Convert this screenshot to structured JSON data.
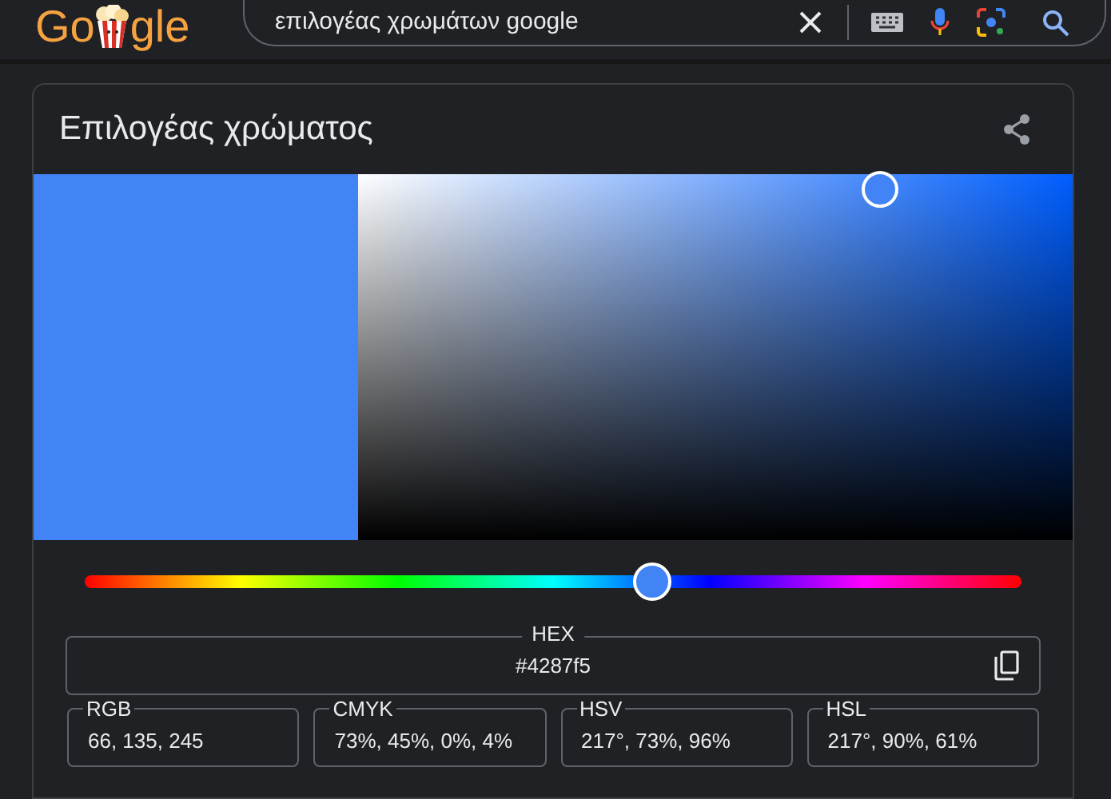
{
  "logo": {
    "before": "Go",
    "after": "gle"
  },
  "search": {
    "value": "επιλογέας χρωμάτων google"
  },
  "card": {
    "title": "Επιλογέας χρώματος",
    "hue": {
      "level": 0.605
    },
    "saturation": {
      "level": 0.73
    },
    "brightness": {
      "level": 0.96
    },
    "hex": {
      "label": "HEX",
      "value": "#4287f5"
    },
    "fields": [
      {
        "label": "RGB",
        "value": "66, 135, 245"
      },
      {
        "label": "CMYK",
        "value": "73%, 45%, 0%, 4%"
      },
      {
        "label": "HSV",
        "value": "217°, 73%, 96%"
      },
      {
        "label": "HSL",
        "value": "217°, 90%, 61%"
      }
    ]
  }
}
